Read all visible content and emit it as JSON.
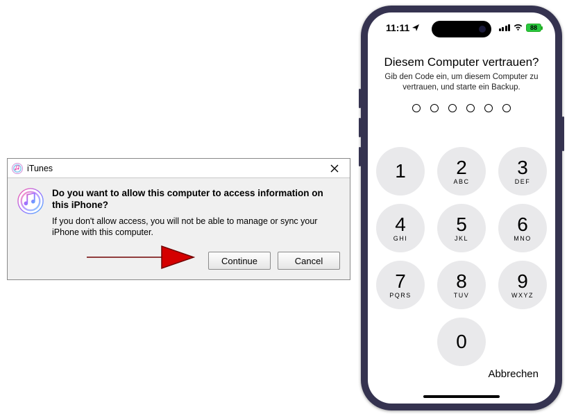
{
  "dialog": {
    "app": "iTunes",
    "heading": "Do you want to allow this computer to access information on this iPhone?",
    "body": "If you don't allow access, you will not be able to manage or sync your iPhone with this computer.",
    "continue": "Continue",
    "cancel": "Cancel"
  },
  "phone": {
    "time": "11:11",
    "battery_pct": "88",
    "trust_title": "Diesem Computer vertrauen?",
    "trust_sub": "Gib den Code ein, um diesem Computer zu vertrauen, und starte ein Backup.",
    "passcode_length": 6,
    "keypad": [
      {
        "n": "1",
        "l": ""
      },
      {
        "n": "2",
        "l": "ABC"
      },
      {
        "n": "3",
        "l": "DEF"
      },
      {
        "n": "4",
        "l": "GHI"
      },
      {
        "n": "5",
        "l": "JKL"
      },
      {
        "n": "6",
        "l": "MNO"
      },
      {
        "n": "7",
        "l": "PQRS"
      },
      {
        "n": "8",
        "l": "TUV"
      },
      {
        "n": "9",
        "l": "WXYZ"
      },
      {
        "n": "0",
        "l": ""
      }
    ],
    "cancel": "Abbrechen"
  }
}
